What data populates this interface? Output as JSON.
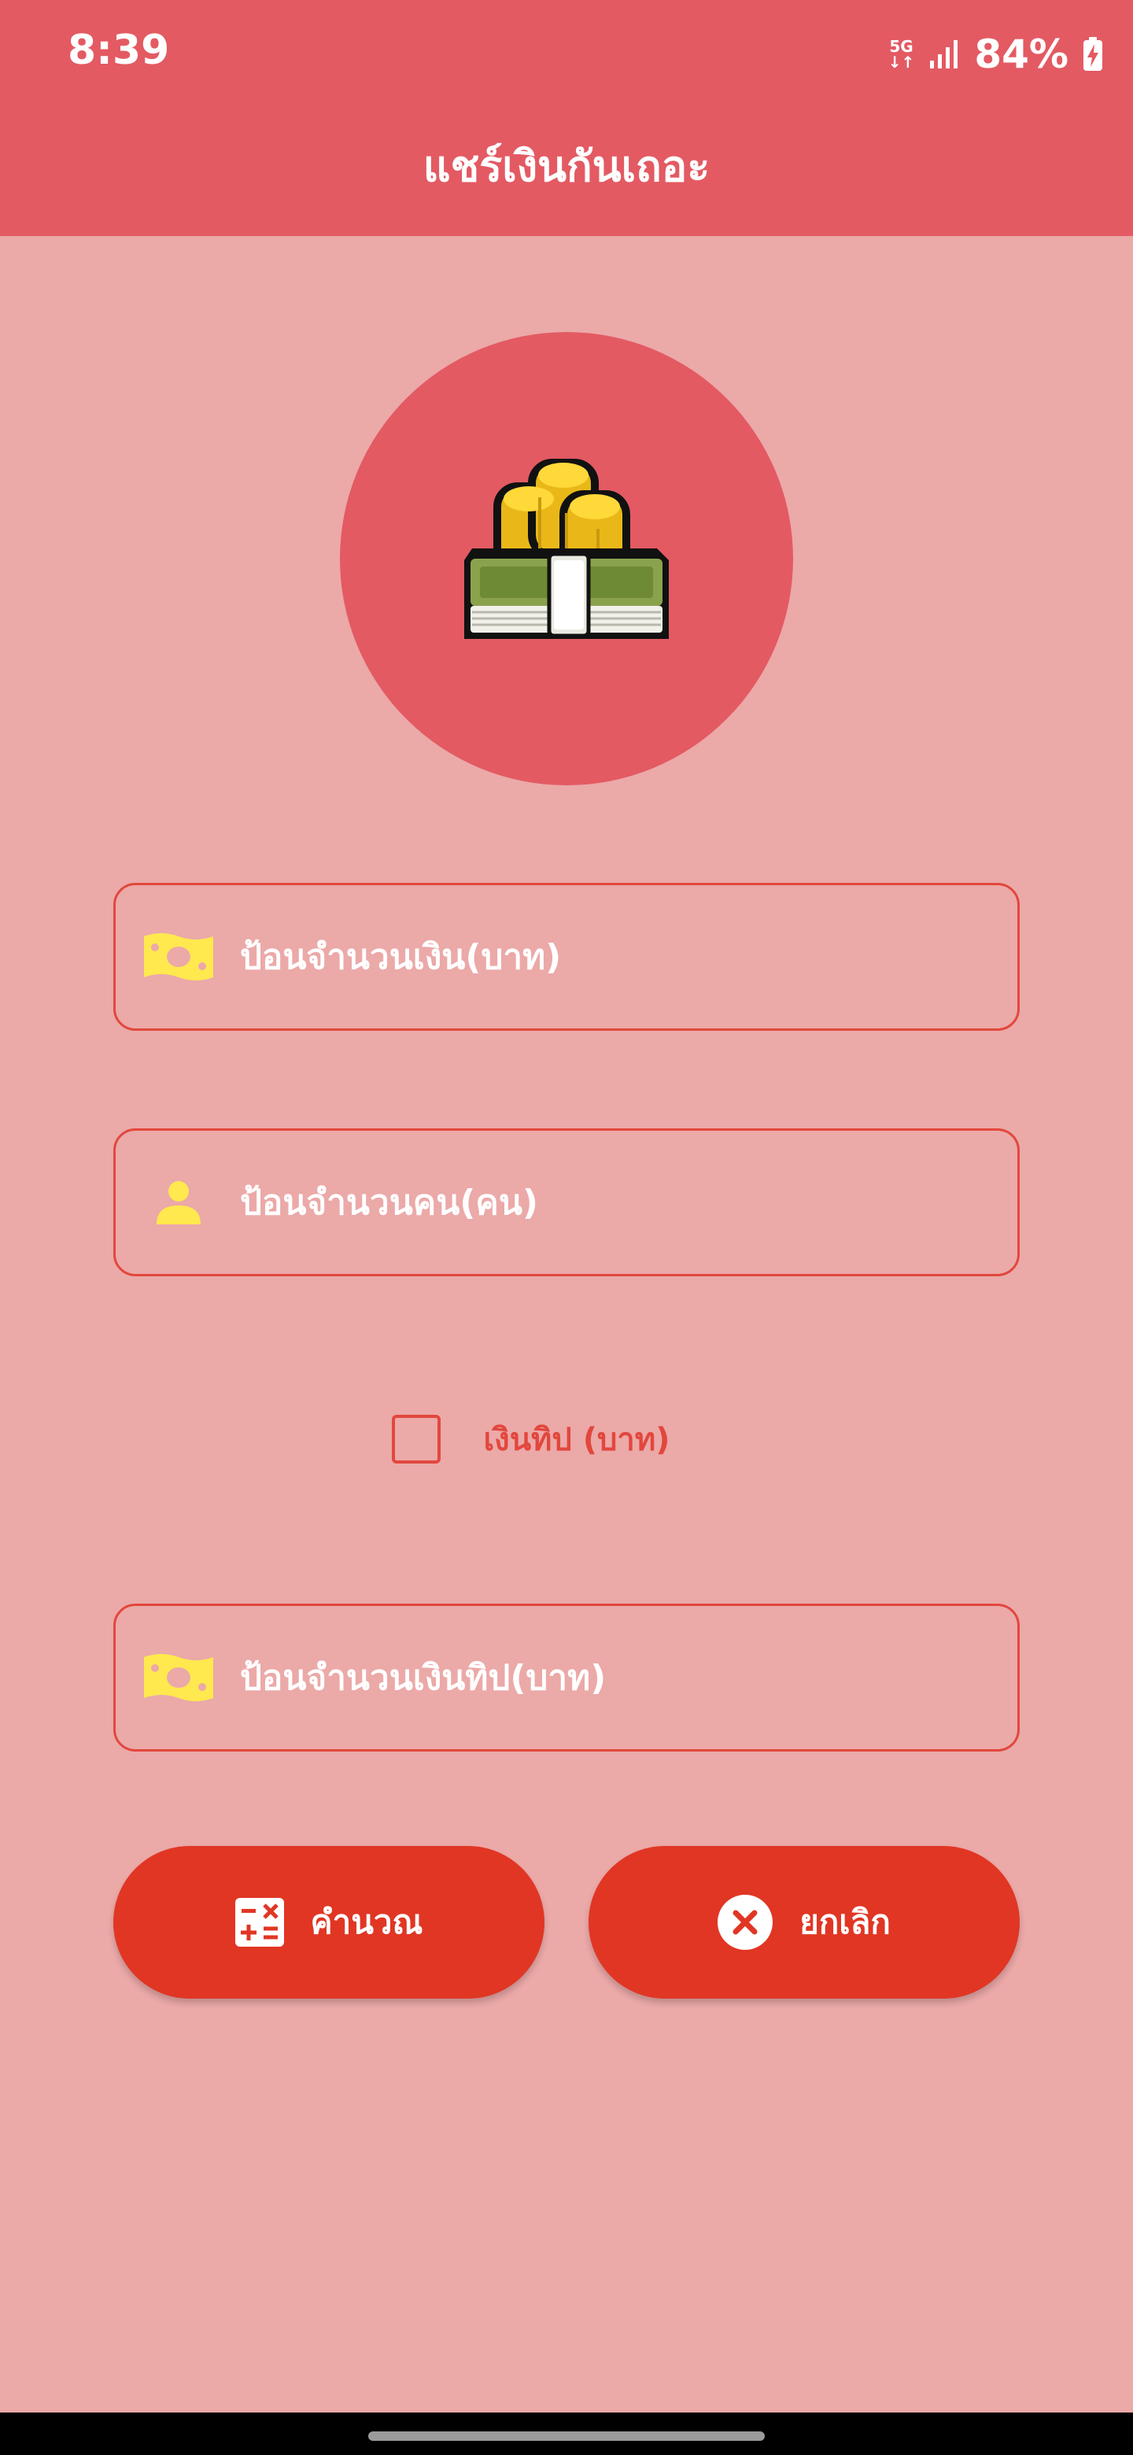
{
  "status_bar": {
    "time": "8:39",
    "network": "5G",
    "battery": "84%"
  },
  "app": {
    "title": "แชร์เงินกันเถอะ"
  },
  "form": {
    "amount_placeholder": "ป้อนจำนวนเงิน(บาท)",
    "people_placeholder": "ป้อนจำนวนคน(คน)",
    "tip_checkbox_label": "เงินทิป (บาท)",
    "tip_checked": false,
    "tip_amount_placeholder": "ป้อนจำนวนเงินทิป(บาท)"
  },
  "buttons": {
    "calculate_label": "คำนวณ",
    "cancel_label": "ยกเลิก"
  },
  "icons": {
    "logo": "money-stack-coins-icon",
    "amount": "banknote-icon",
    "people": "person-icon",
    "tip": "banknote-icon",
    "calculate": "calculator-icon",
    "cancel": "close-circle-icon"
  },
  "colors": {
    "header": "#E35A63",
    "background": "#EBA9A8",
    "accent": "#E2473D",
    "button": "#E13624",
    "icon_yellow": "#FFE94E"
  }
}
